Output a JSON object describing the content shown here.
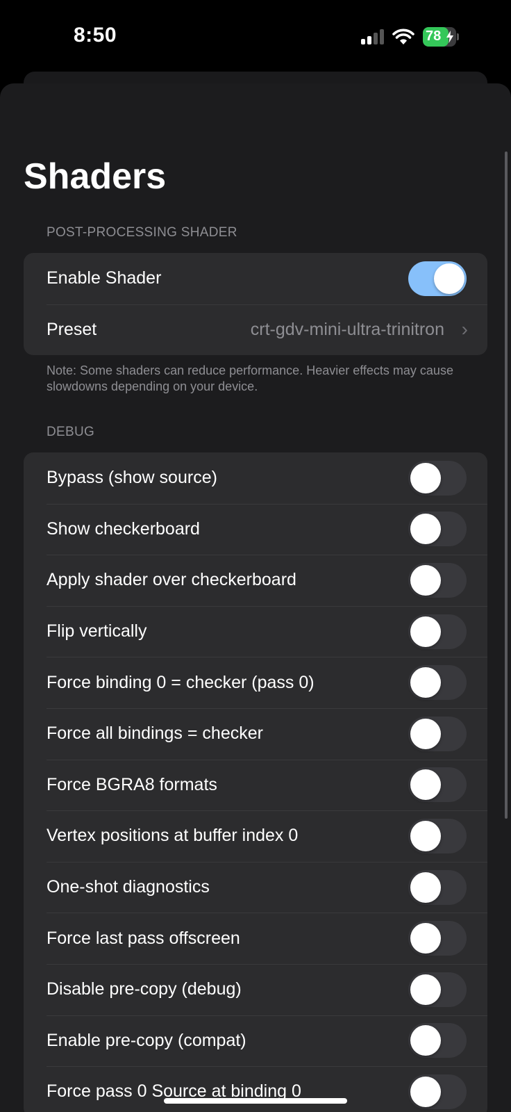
{
  "status_bar": {
    "time": "8:50",
    "battery_level": "78",
    "battery_color": "#34c759"
  },
  "page": {
    "title": "Shaders"
  },
  "post_processing": {
    "header": "POST-PROCESSING SHADER",
    "enable_shader_label": "Enable Shader",
    "enable_shader_on": true,
    "preset_label": "Preset",
    "preset_value": "crt-gdv-mini-ultra-trinitron",
    "note": "Note: Some shaders can reduce performance. Heavier effects may cause slowdowns depending on your device."
  },
  "debug": {
    "header": "DEBUG",
    "items": [
      {
        "label": "Bypass (show source)",
        "on": false
      },
      {
        "label": "Show checkerboard",
        "on": false
      },
      {
        "label": "Apply shader over checkerboard",
        "on": false
      },
      {
        "label": "Flip vertically",
        "on": false
      },
      {
        "label": "Force binding 0 = checker (pass 0)",
        "on": false
      },
      {
        "label": "Force all bindings = checker",
        "on": false
      },
      {
        "label": "Force BGRA8 formats",
        "on": false
      },
      {
        "label": "Vertex positions at buffer index 0",
        "on": false
      },
      {
        "label": "One-shot diagnostics",
        "on": false
      },
      {
        "label": "Force last pass offscreen",
        "on": false
      },
      {
        "label": "Disable pre-copy (debug)",
        "on": false
      },
      {
        "label": "Enable pre-copy (compat)",
        "on": false
      },
      {
        "label": "Force pass 0 Source at binding 0",
        "on": false
      }
    ]
  },
  "colors": {
    "accent_toggle_on": "#87c0fa",
    "toggle_off": "#39393d",
    "background": "#1c1c1e",
    "group_background": "#2c2c2e"
  }
}
